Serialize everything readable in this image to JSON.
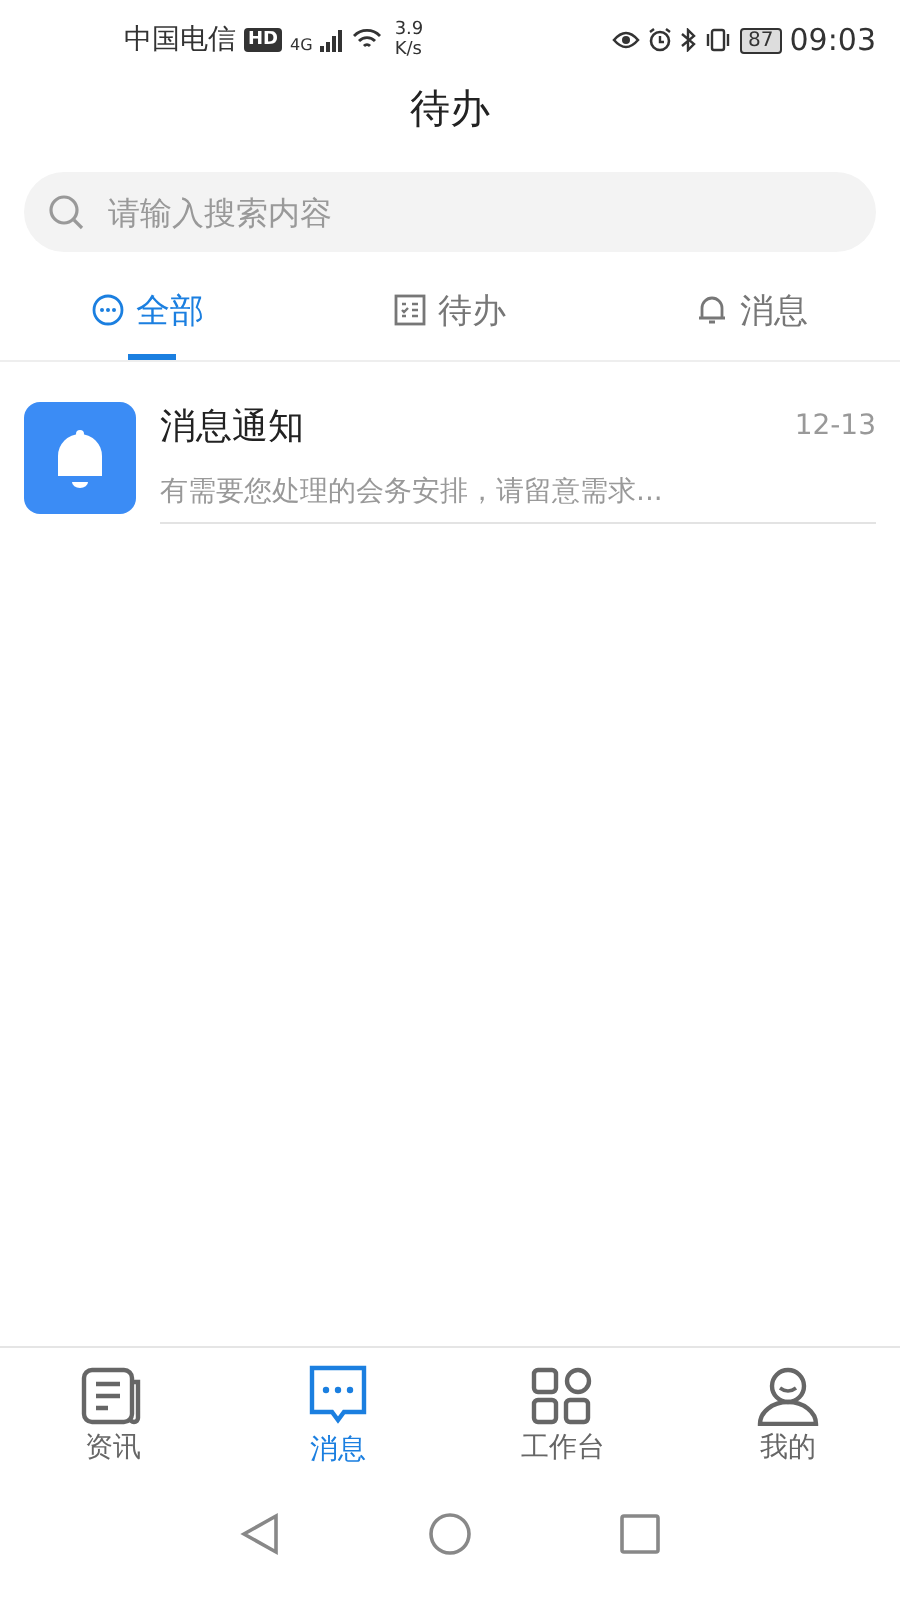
{
  "status_bar": {
    "carrier": "中国电信",
    "hd_badge": "HD",
    "network": "4G",
    "speed_value": "3.9",
    "speed_unit": "K/s",
    "battery": "87",
    "time": "09:03"
  },
  "header": {
    "title": "待办"
  },
  "search": {
    "placeholder": "请输入搜索内容"
  },
  "tabs": [
    {
      "label": "全部",
      "kind": "all",
      "selected": true
    },
    {
      "label": "待办",
      "kind": "todo",
      "selected": false
    },
    {
      "label": "消息",
      "kind": "message",
      "selected": false
    }
  ],
  "messages": [
    {
      "title": "消息通知",
      "date": "12-13",
      "preview": "有需要您处理的会务安排，请留意需求..."
    }
  ],
  "bottom_nav": [
    {
      "label": "资讯",
      "kind": "news",
      "selected": false
    },
    {
      "label": "消息",
      "kind": "message",
      "selected": true
    },
    {
      "label": "工作台",
      "kind": "workbench",
      "selected": false
    },
    {
      "label": "我的",
      "kind": "profile",
      "selected": false
    }
  ]
}
